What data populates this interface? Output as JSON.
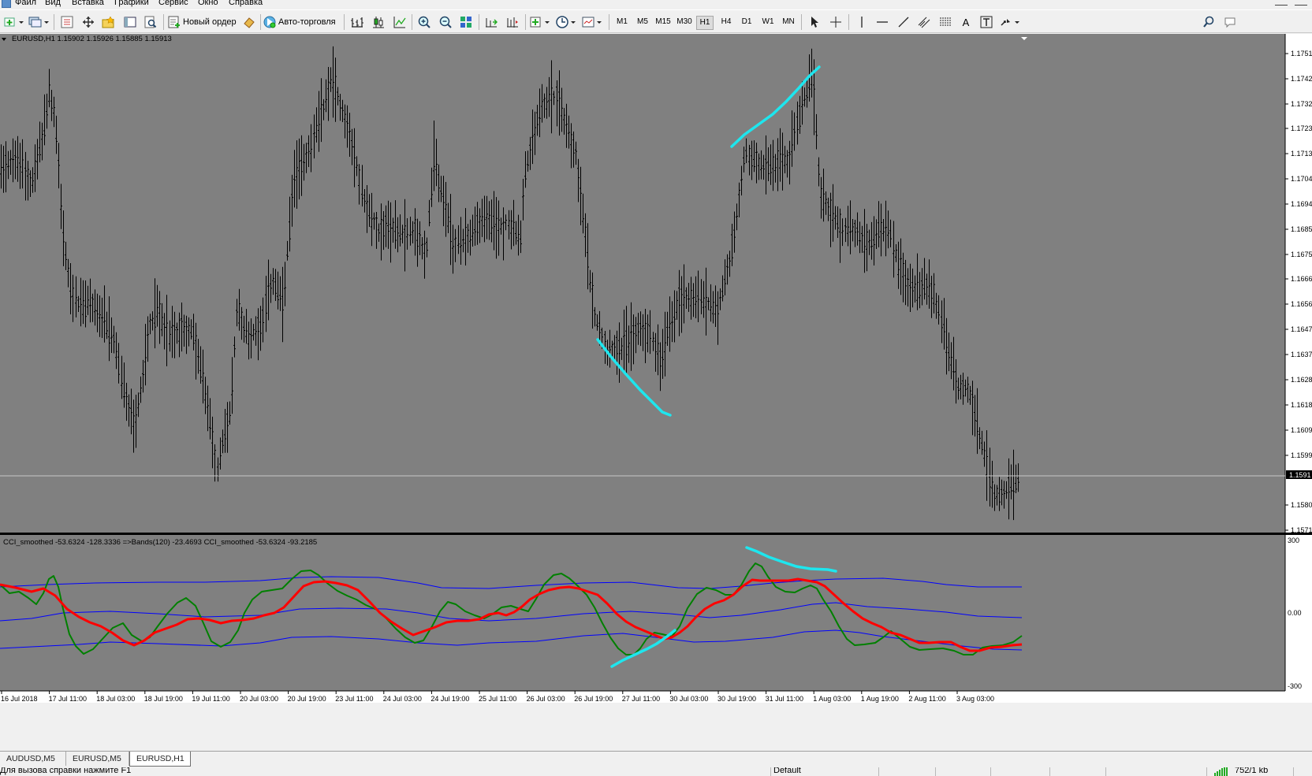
{
  "menu": {
    "items": [
      "Файл",
      "Вид",
      "Вставка",
      "Графики",
      "Сервис",
      "Окно",
      "Справка"
    ]
  },
  "toolbar": {
    "new_order_label": "Новый ордер",
    "autotrading_label": "Авто-торговля",
    "timeframes": [
      "M1",
      "M5",
      "M15",
      "M30",
      "H1",
      "H4",
      "D1",
      "W1",
      "MN"
    ],
    "active_timeframe": "H1",
    "text_tool_label": "A"
  },
  "chart": {
    "header": "EURUSD,H1  1.15902 1.15926 1.15885 1.15913",
    "current_price_label": "1.1591",
    "price_ticks": [
      "1.1751",
      "1.1742",
      "1.1732",
      "1.1723",
      "1.1713",
      "1.1704",
      "1.1694",
      "1.1685",
      "1.1675",
      "1.1666",
      "1.1656",
      "1.1647",
      "1.1637",
      "1.1628",
      "1.1618",
      "1.1609",
      "1.1599",
      "1.1580",
      "1.1571"
    ],
    "indicator_header": "CCI_smoothed -53.6324 -128.3336   =>Bands(120) -23.4693   CCI_smoothed -53.6324 -93.2185",
    "indicator_ticks": [
      "300",
      "0.00",
      "-300"
    ],
    "date_ticks": [
      "16 Jul 2018",
      "17 Jul 11:00",
      "18 Jul 03:00",
      "18 Jul 19:00",
      "19 Jul 11:00",
      "20 Jul 03:00",
      "20 Jul 19:00",
      "23 Jul 11:00",
      "24 Jul 03:00",
      "24 Jul 19:00",
      "25 Jul 11:00",
      "26 Jul 03:00",
      "26 Jul 19:00",
      "27 Jul 11:00",
      "30 Jul 03:00",
      "30 Jul 19:00",
      "31 Jul 11:00",
      "1 Aug 03:00",
      "1 Aug 19:00",
      "2 Aug 11:00",
      "3 Aug 03:00"
    ],
    "colors": {
      "background": "#808080",
      "candles": "#000000",
      "annotation": "#1ee6ee",
      "cci_fast": "#008000",
      "cci_slow": "#ff0000",
      "bands": "#0000ff"
    }
  },
  "tabs": {
    "items": [
      "AUDUSD,M5",
      "EURUSD,M5",
      "EURUSD,H1"
    ],
    "active": "EURUSD,H1"
  },
  "status": {
    "help": "Для вызова справки нажмите F1",
    "profile": "Default",
    "connection": "752/1 kb"
  }
}
